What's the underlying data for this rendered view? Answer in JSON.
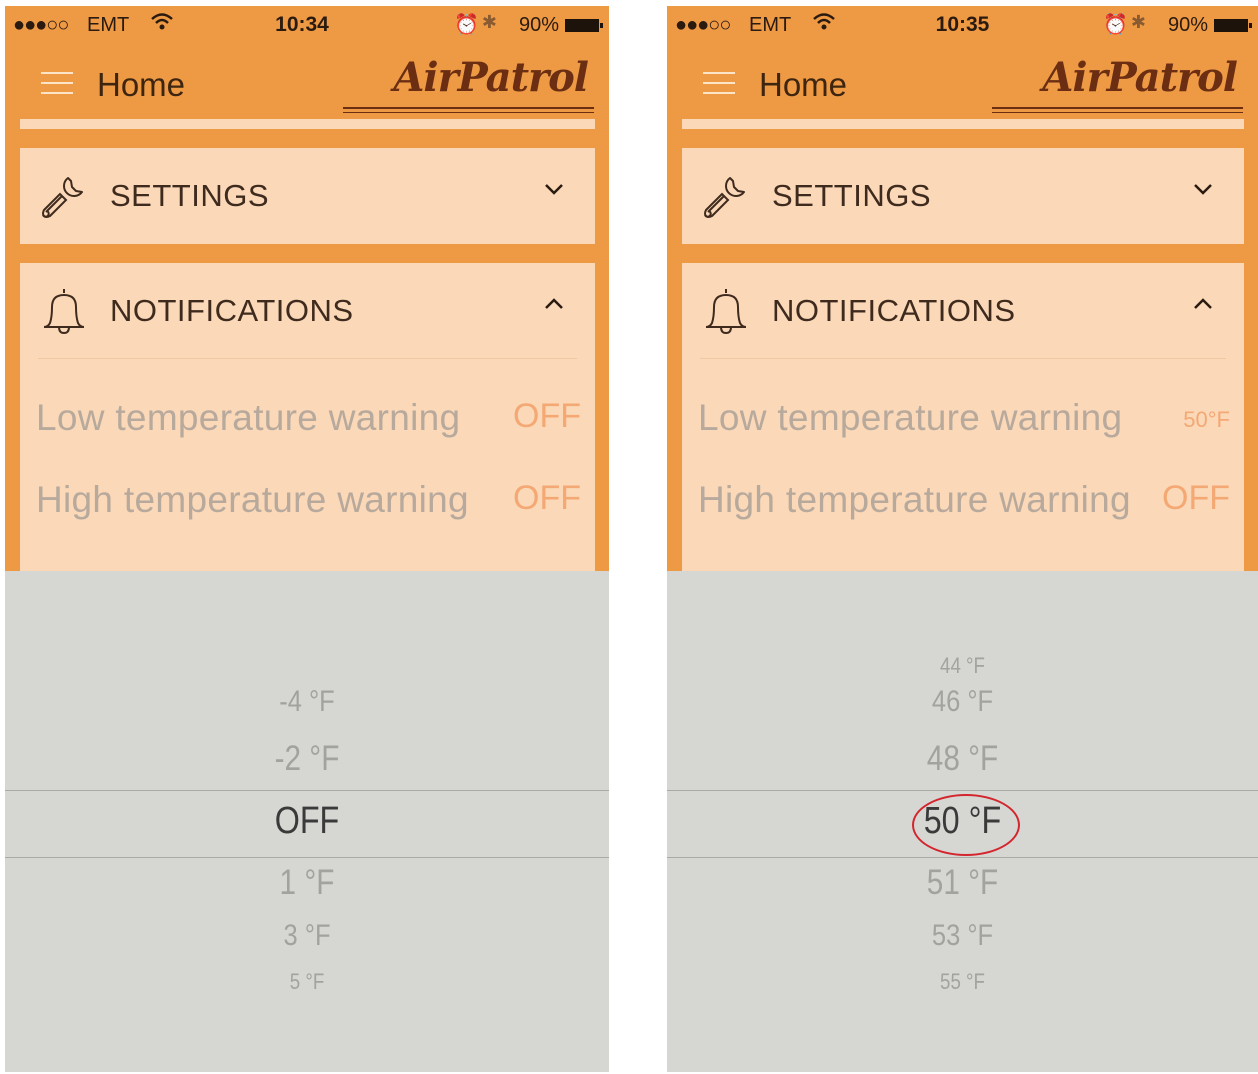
{
  "screens": [
    {
      "status": {
        "signal": "●●●○○",
        "carrier": "EMT",
        "time": "10:34",
        "battery": "90%"
      },
      "nav": {
        "title": "Home",
        "logo": "AirPatrol"
      },
      "settings": {
        "title": "SETTINGS"
      },
      "notifications": {
        "title": "NOTIFICATIONS",
        "rows": [
          {
            "label": "Low temperature warning",
            "value": "OFF"
          },
          {
            "label": "High temperature warning",
            "value": "OFF"
          }
        ]
      },
      "picker": {
        "above": [
          "-4 °F",
          "-2 °F"
        ],
        "selected": "OFF",
        "below": [
          "1 °F",
          "3 °F",
          "5 °F"
        ]
      }
    },
    {
      "status": {
        "signal": "●●●○○",
        "carrier": "EMT",
        "time": "10:35",
        "battery": "90%"
      },
      "nav": {
        "title": "Home",
        "logo": "AirPatrol"
      },
      "settings": {
        "title": "SETTINGS"
      },
      "notifications": {
        "title": "NOTIFICATIONS",
        "rows": [
          {
            "label": "Low temperature warning",
            "value": "50°F"
          },
          {
            "label": "High temperature warning",
            "value": "OFF"
          }
        ]
      },
      "picker": {
        "above": [
          "44 °F",
          "46 °F",
          "48 °F"
        ],
        "selected": "50 °F",
        "below": [
          "51 °F",
          "53 °F",
          "55 °F"
        ]
      }
    }
  ]
}
